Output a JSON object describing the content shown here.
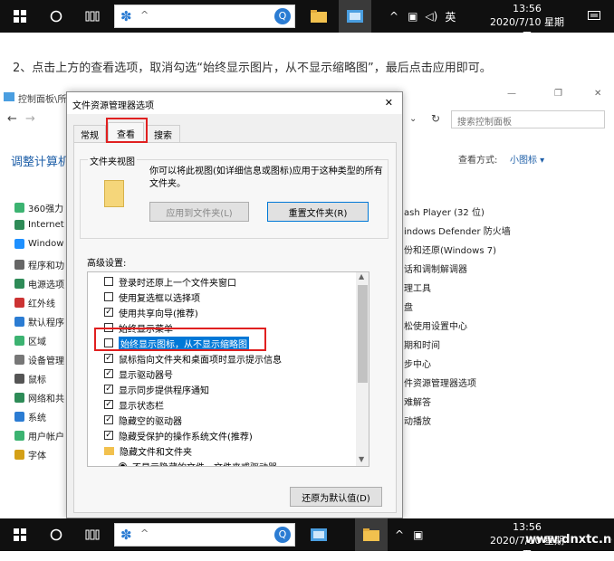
{
  "instruction": "2、点击上方的查看选项，取消勾选“始终显示图片，从不显示缩略图”，最后点击应用即可。",
  "taskbar_top": {
    "tray_lang": "英",
    "clock_time": "13:56",
    "clock_date": "2020/7/10 星期五"
  },
  "taskbar_bottom": {
    "clock_time": "13:56",
    "clock_date": "2020/7/10 星期五"
  },
  "watermark": "www.dnxtc.net",
  "control_panel": {
    "title": "控制面板\\所",
    "search_placeholder": "搜索控制面板",
    "heading": "调整计算机",
    "view_label": "查看方式:",
    "view_value": "小图标 ▾",
    "left_items": [
      "360强力",
      "Internet",
      "Window",
      "程序和功",
      "电源选项",
      "红外线",
      "默认程序",
      "区域",
      "设备管理",
      "鼠标",
      "网络和共",
      "系统",
      "用户帐户",
      "字体"
    ],
    "right_items": [
      "ash Player (32 位)",
      "indows Defender 防火墙",
      "份和还原(Windows 7)",
      "话和调制解调器",
      "理工具",
      "盘",
      "松使用设置中心",
      "期和时间",
      "步中心",
      "件资源管理器选项",
      "难解答",
      "动播放"
    ]
  },
  "dialog": {
    "title": "文件资源管理器选项",
    "close": "✕",
    "tabs": [
      "常规",
      "查看",
      "搜索"
    ],
    "folder_views_label": "文件夹视图",
    "folder_views_desc": "你可以将此视图(如详细信息或图标)应用于这种类型的所有文件夹。",
    "apply_to_folders": "应用到文件夹(L)",
    "reset_folders": "重置文件夹(R)",
    "advanced_label": "高级设置:",
    "settings": [
      {
        "label": "登录时还原上一个文件夹窗口",
        "checked": false
      },
      {
        "label": "使用复选框以选择项",
        "checked": false
      },
      {
        "label": "使用共享向导(推荐)",
        "checked": true
      },
      {
        "label": "始终显示菜单",
        "checked": false
      },
      {
        "label": "始终显示图标，从不显示缩略图",
        "checked": false
      },
      {
        "label": "鼠标指向文件夹和桌面项时显示提示信息",
        "checked": true
      },
      {
        "label": "显示驱动器号",
        "checked": true
      },
      {
        "label": "显示同步提供程序通知",
        "checked": true
      },
      {
        "label": "显示状态栏",
        "checked": true
      },
      {
        "label": "隐藏空的驱动器",
        "checked": true
      },
      {
        "label": "隐藏受保护的操作系统文件(推荐)",
        "checked": true
      },
      {
        "label": "隐藏文件和文件夹",
        "checked": null
      },
      {
        "label": "不显示隐藏的文件、文件夹或驱动器",
        "checked": null
      }
    ],
    "restore_defaults": "还原为默认值(D)"
  }
}
